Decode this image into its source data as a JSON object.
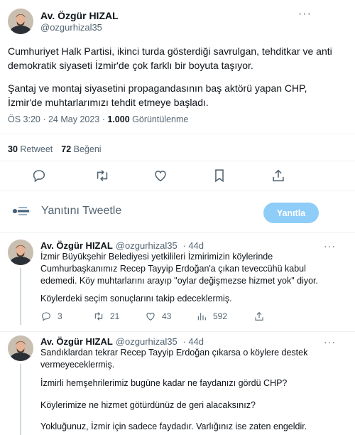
{
  "main_tweet": {
    "author_name": "Av. Özgür HIZAL",
    "author_handle": "@ozgurhizal35",
    "paragraph_1": "Cumhuriyet Halk Partisi, ikinci turda gösterdiği savrulgan, tehditkar ve anti demokratik siyaseti İzmir'de çok farklı bir boyuta taşıyor.",
    "paragraph_2": "Şantaj ve montaj siyasetini propagandasının baş aktörü yapan CHP, İzmir'de muhtarlarımızı tehdit etmeye başladı.",
    "time": "ÖS 3:20",
    "date": "24 May 2023",
    "views_count": "1.000",
    "views_label": "Görüntülenme",
    "retweets_count": "30",
    "retweets_label": "Retweet",
    "likes_count": "72",
    "likes_label": "Beğeni",
    "more_glyph": "···"
  },
  "composer": {
    "placeholder": "Yanıtını Tweetle",
    "reply_button": "Yanıtla"
  },
  "replies": [
    {
      "author_name": "Av. Özgür HIZAL",
      "author_handle": "@ozgurhizal35",
      "age": "44d",
      "lines": [
        "İzmir Büyükşehir Belediyesi yetkilileri İzmirimizin köylerinde Cumhurbaşkanımız Recep Tayyip Erdoğan'a çıkan teveccühü kabul edemedi. Köy muhtarlarını arayıp \"oylar değişmezse hizmet yok\" diyor.",
        "Köylerdeki seçim sonuçlarını takip edeceklermiş."
      ],
      "replies_count": "3",
      "retweets_count": "21",
      "likes_count": "43",
      "views_count": "592"
    },
    {
      "author_name": "Av. Özgür HIZAL",
      "author_handle": "@ozgurhizal35",
      "age": "44d",
      "lines": [
        "Sandıklardan tekrar Recep Tayyip Erdoğan çıkarsa o köylere destek vermeyeceklermiş.",
        "İzmirli hemşehrilerimiz bugüne kadar ne faydanızı gördü CHP?",
        "Köylerimize ne hizmet götürdünüz de geri alacaksınız?",
        "Yokluğunuz, İzmir için sadece faydadır. Varlığınız ise zaten engeldir."
      ]
    }
  ]
}
